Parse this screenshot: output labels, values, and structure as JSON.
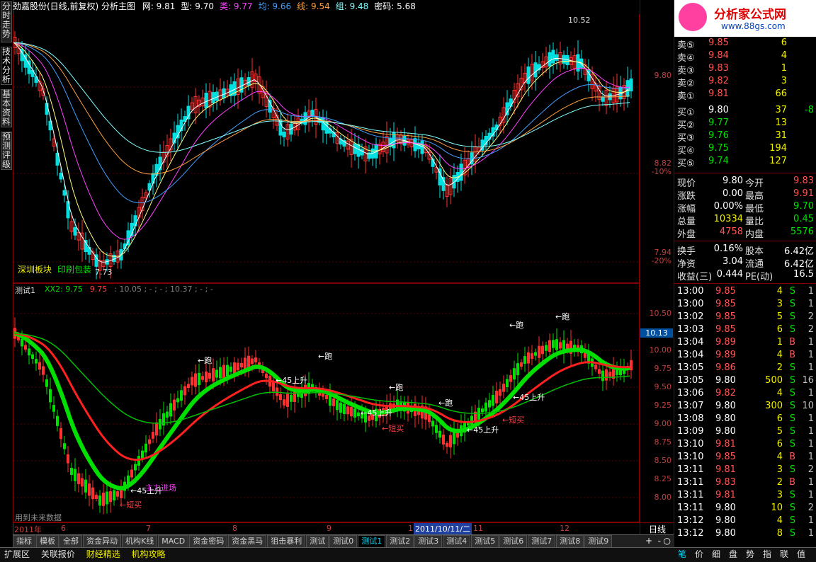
{
  "left_tabs": [
    "分时走势",
    "技术分析",
    "基本资料",
    "预测评级"
  ],
  "header": {
    "title": "劲嘉股份(日线,前复权) 分析主图",
    "items": [
      {
        "label": "网: 9.81",
        "color": "#ffffff"
      },
      {
        "label": "型: 9.70",
        "color": "#ffffff"
      },
      {
        "label": "类: 9.77",
        "color": "#ff40ff"
      },
      {
        "label": "均: 9.66",
        "color": "#40a0ff"
      },
      {
        "label": "线: 9.54",
        "color": "#ffa040"
      },
      {
        "label": "组: 9.48",
        "color": "#80ffff"
      },
      {
        "label": "密码: 5.68",
        "color": "#ffffff"
      }
    ]
  },
  "main_chart": {
    "high_label": "10.52",
    "low_label": "7.73",
    "axis_labels": [
      {
        "text": "9.80",
        "color": "#c04040"
      },
      {
        "text": "8.82",
        "color": "#c04040"
      },
      {
        "text": "-10%",
        "color": "#c04040"
      },
      {
        "text": "7.94",
        "color": "#c04040"
      },
      {
        "text": "-20%",
        "color": "#c04040"
      }
    ],
    "notes": [
      "深圳板块",
      "印刷包装"
    ]
  },
  "sub_chart": {
    "title": "测试1",
    "legend": [
      {
        "label": "XX2: 9.75",
        "color": "#00e000"
      },
      {
        "label": "9.75",
        "color": "#ff4040"
      },
      {
        "label": ": 10.05 ; - ; - ; 10.37 ; - ; -",
        "color": "#808080"
      }
    ],
    "axis_labels": [
      "10.50",
      "10.00",
      "9.75",
      "9.50",
      "9.25",
      "9.00",
      "8.75",
      "8.50",
      "8.25",
      "8.00"
    ],
    "current_price_tag": "10.13",
    "annotations": [
      {
        "text": "←跑",
        "color": "#ffffff"
      },
      {
        "text": "←45上升",
        "color": "#ffffff"
      },
      {
        "text": "←短买",
        "color": "#ff4040"
      },
      {
        "text": "主力进场",
        "color": "#ff40ff"
      }
    ],
    "footer_note": "用到未来数据"
  },
  "time_axis": {
    "labels": [
      "2011年",
      "6",
      "7",
      "8",
      "9",
      "10",
      "11",
      "12"
    ],
    "date_tag": "2011/10/11/二",
    "period": "日线"
  },
  "indicator_tabs": [
    "指标",
    "模板",
    "全部",
    "资金异动",
    "机构K线",
    "MACD",
    "资金密码",
    "资金黑马",
    "狙击暴利",
    "测试",
    "测试0",
    "测试1",
    "测试2",
    "测试3",
    "测试4",
    "测试5",
    "测试6",
    "测试7",
    "测试8",
    "测试9"
  ],
  "active_indicator_tab": "测试1",
  "bottom_tabs": [
    "扩展区",
    "关联报价",
    "财经精选",
    "机构攻略"
  ],
  "logo": {
    "text": "分析家公式网",
    "url": "www.88gs.com"
  },
  "order_book": {
    "asks": [
      {
        "label": "卖⑤",
        "price": "9.85",
        "vol": "6"
      },
      {
        "label": "卖④",
        "price": "9.84",
        "vol": "4"
      },
      {
        "label": "卖③",
        "price": "9.83",
        "vol": "1"
      },
      {
        "label": "卖②",
        "price": "9.82",
        "vol": "3"
      },
      {
        "label": "卖①",
        "price": "9.81",
        "vol": "66"
      }
    ],
    "bids": [
      {
        "label": "买①",
        "price": "9.80",
        "vol": "37",
        "chg": "-8"
      },
      {
        "label": "买②",
        "price": "9.77",
        "vol": "13",
        "chg": ""
      },
      {
        "label": "买③",
        "price": "9.76",
        "vol": "31",
        "chg": ""
      },
      {
        "label": "买④",
        "price": "9.75",
        "vol": "194",
        "chg": ""
      },
      {
        "label": "买⑤",
        "price": "9.74",
        "vol": "127",
        "chg": ""
      }
    ]
  },
  "stats": [
    {
      "l1": "现价",
      "v1": "9.80",
      "c1": "#ffffff",
      "l2": "今开",
      "v2": "9.83",
      "c2": "#ff5555"
    },
    {
      "l1": "涨跌",
      "v1": "0.00",
      "c1": "#ffffff",
      "l2": "最高",
      "v2": "9.91",
      "c2": "#ff5555"
    },
    {
      "l1": "涨幅",
      "v1": "0.00%",
      "c1": "#ffffff",
      "l2": "最低",
      "v2": "9.70",
      "c2": "#00e000"
    },
    {
      "l1": "总量",
      "v1": "10334",
      "c1": "#f0f000",
      "l2": "量比",
      "v2": "0.45",
      "c2": "#00e000"
    },
    {
      "l1": "外盘",
      "v1": "4758",
      "c1": "#ff5555",
      "l2": "内盘",
      "v2": "5576",
      "c2": "#00e000"
    }
  ],
  "stats2": [
    {
      "l1": "换手",
      "v1": "0.16%",
      "l2": "股本",
      "v2": "6.42亿"
    },
    {
      "l1": "净资",
      "v1": "3.04",
      "l2": "流通",
      "v2": "6.42亿"
    },
    {
      "l1": "收益(三)",
      "v1": "0.444",
      "l2": "PE(动)",
      "v2": "16.5"
    }
  ],
  "ticks": [
    {
      "time": "13:00",
      "price": "9.85",
      "pc": "#ff5555",
      "vol": "4",
      "side": "S",
      "n": "1"
    },
    {
      "time": "13:00",
      "price": "9.85",
      "pc": "#ff5555",
      "vol": "3",
      "side": "S",
      "n": "1"
    },
    {
      "time": "13:02",
      "price": "9.85",
      "pc": "#ff5555",
      "vol": "5",
      "side": "S",
      "n": "2"
    },
    {
      "time": "13:03",
      "price": "9.85",
      "pc": "#ff5555",
      "vol": "6",
      "side": "S",
      "n": "2"
    },
    {
      "time": "13:04",
      "price": "9.89",
      "pc": "#ff5555",
      "vol": "1",
      "side": "B",
      "n": "1"
    },
    {
      "time": "13:04",
      "price": "9.89",
      "pc": "#ff5555",
      "vol": "4",
      "side": "B",
      "n": "1"
    },
    {
      "time": "13:05",
      "price": "9.86",
      "pc": "#ff5555",
      "vol": "2",
      "side": "S",
      "n": "1"
    },
    {
      "time": "13:05",
      "price": "9.80",
      "pc": "#ffffff",
      "vol": "500",
      "side": "S",
      "n": "16"
    },
    {
      "time": "13:06",
      "price": "9.82",
      "pc": "#ff5555",
      "vol": "4",
      "side": "S",
      "n": "1"
    },
    {
      "time": "13:07",
      "price": "9.80",
      "pc": "#ffffff",
      "vol": "300",
      "side": "S",
      "n": "10"
    },
    {
      "time": "13:08",
      "price": "9.80",
      "pc": "#ffffff",
      "vol": "6",
      "side": "S",
      "n": "1"
    },
    {
      "time": "13:09",
      "price": "9.80",
      "pc": "#ffffff",
      "vol": "5",
      "side": "S",
      "n": "1"
    },
    {
      "time": "13:10",
      "price": "9.81",
      "pc": "#ff5555",
      "vol": "6",
      "side": "S",
      "n": "1"
    },
    {
      "time": "13:10",
      "price": "9.85",
      "pc": "#ff5555",
      "vol": "4",
      "side": "B",
      "n": "1"
    },
    {
      "time": "13:11",
      "price": "9.81",
      "pc": "#ff5555",
      "vol": "3",
      "side": "S",
      "n": "2"
    },
    {
      "time": "13:11",
      "price": "9.83",
      "pc": "#ff5555",
      "vol": "2",
      "side": "B",
      "n": "1"
    },
    {
      "time": "13:11",
      "price": "9.81",
      "pc": "#ff5555",
      "vol": "3",
      "side": "S",
      "n": "1"
    },
    {
      "time": "13:11",
      "price": "9.80",
      "pc": "#ffffff",
      "vol": "10",
      "side": "S",
      "n": "2"
    },
    {
      "time": "13:12",
      "price": "9.80",
      "pc": "#ffffff",
      "vol": "4",
      "side": "S",
      "n": "1"
    },
    {
      "time": "13:12",
      "price": "9.80",
      "pc": "#ffffff",
      "vol": "8",
      "side": "S",
      "n": "1"
    }
  ],
  "right_tabs": [
    "笔",
    "价",
    "细",
    "盘",
    "势",
    "指",
    "联",
    "值"
  ],
  "active_right_tab": "笔"
}
